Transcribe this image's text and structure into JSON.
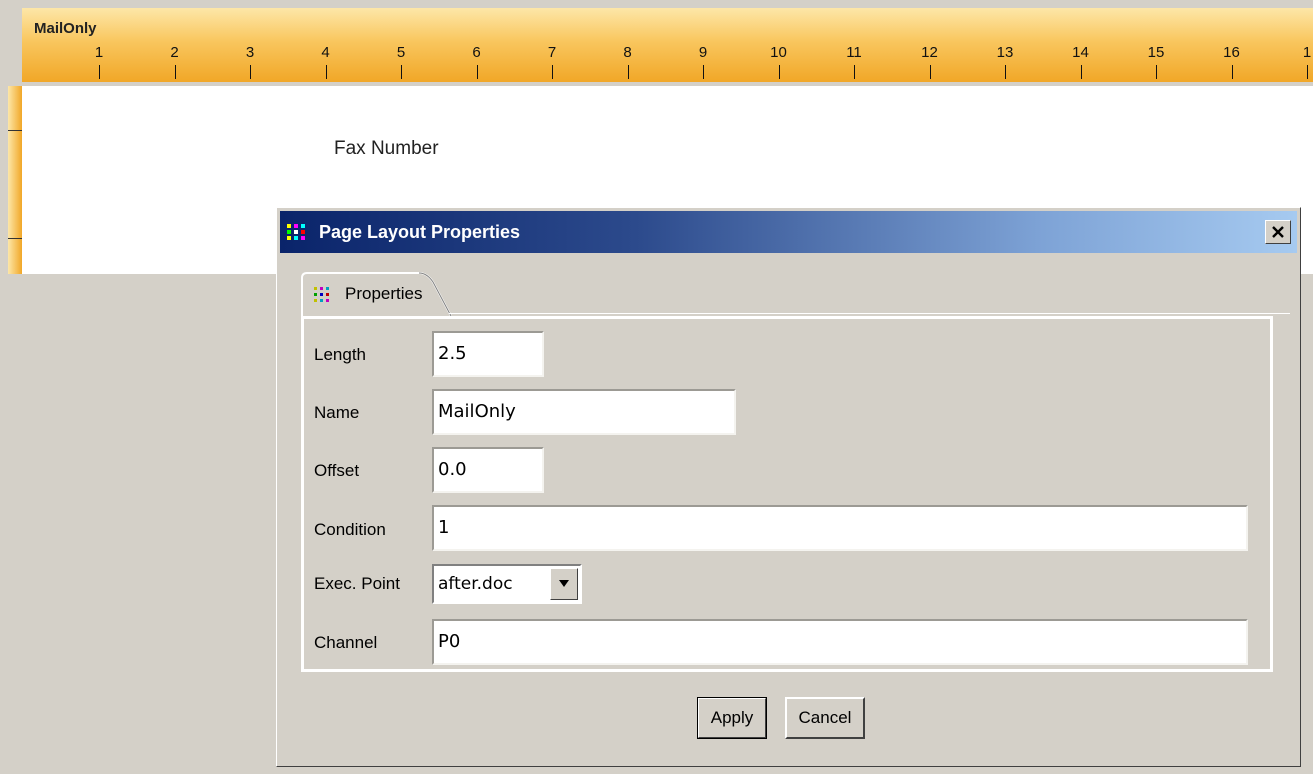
{
  "ruler": {
    "band_name": "MailOnly",
    "numbers": [
      "1",
      "2",
      "3",
      "4",
      "5",
      "6",
      "7",
      "8",
      "9",
      "10",
      "11",
      "12",
      "13",
      "14",
      "15",
      "16",
      "1"
    ]
  },
  "page": {
    "field_label": "Fax Number"
  },
  "dialog": {
    "title": "Page Layout Properties",
    "close_label": "x",
    "tab_label": "Properties",
    "fields": {
      "length": {
        "label": "Length",
        "value": "2.5"
      },
      "name": {
        "label": "Name",
        "value": "MailOnly"
      },
      "offset": {
        "label": "Offset",
        "value": "0.0"
      },
      "condition": {
        "label": "Condition",
        "value": "1"
      },
      "exec_point": {
        "label": "Exec. Point",
        "value": "after.doc"
      },
      "channel": {
        "label": "Channel",
        "value": "P0"
      }
    },
    "buttons": {
      "apply": "Apply",
      "cancel": "Cancel"
    }
  },
  "colors": {
    "ruler_accent": "#f1a727",
    "titlebar_start": "#0a246a",
    "titlebar_end": "#a6caf0",
    "dialog_face": "#d4d0c8"
  },
  "icons": {
    "title_icon": "dot-grid-icon",
    "tab_icon": "dot-grid-icon",
    "close_icon": "close-icon",
    "dropdown_icon": "dropdown-arrow-icon"
  }
}
